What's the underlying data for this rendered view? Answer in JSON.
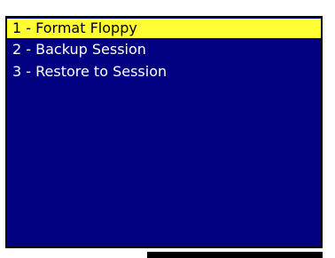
{
  "colors": {
    "panel_background": "#000080",
    "selection_background": "#ffff33",
    "selection_text": "#000000",
    "item_text": "#ffffff",
    "border": "#000000"
  },
  "menu": {
    "selected_index": 0,
    "items": [
      {
        "label": "1 - Format Floppy"
      },
      {
        "label": "2 - Backup Session"
      },
      {
        "label": "3 - Restore to Session"
      }
    ]
  }
}
